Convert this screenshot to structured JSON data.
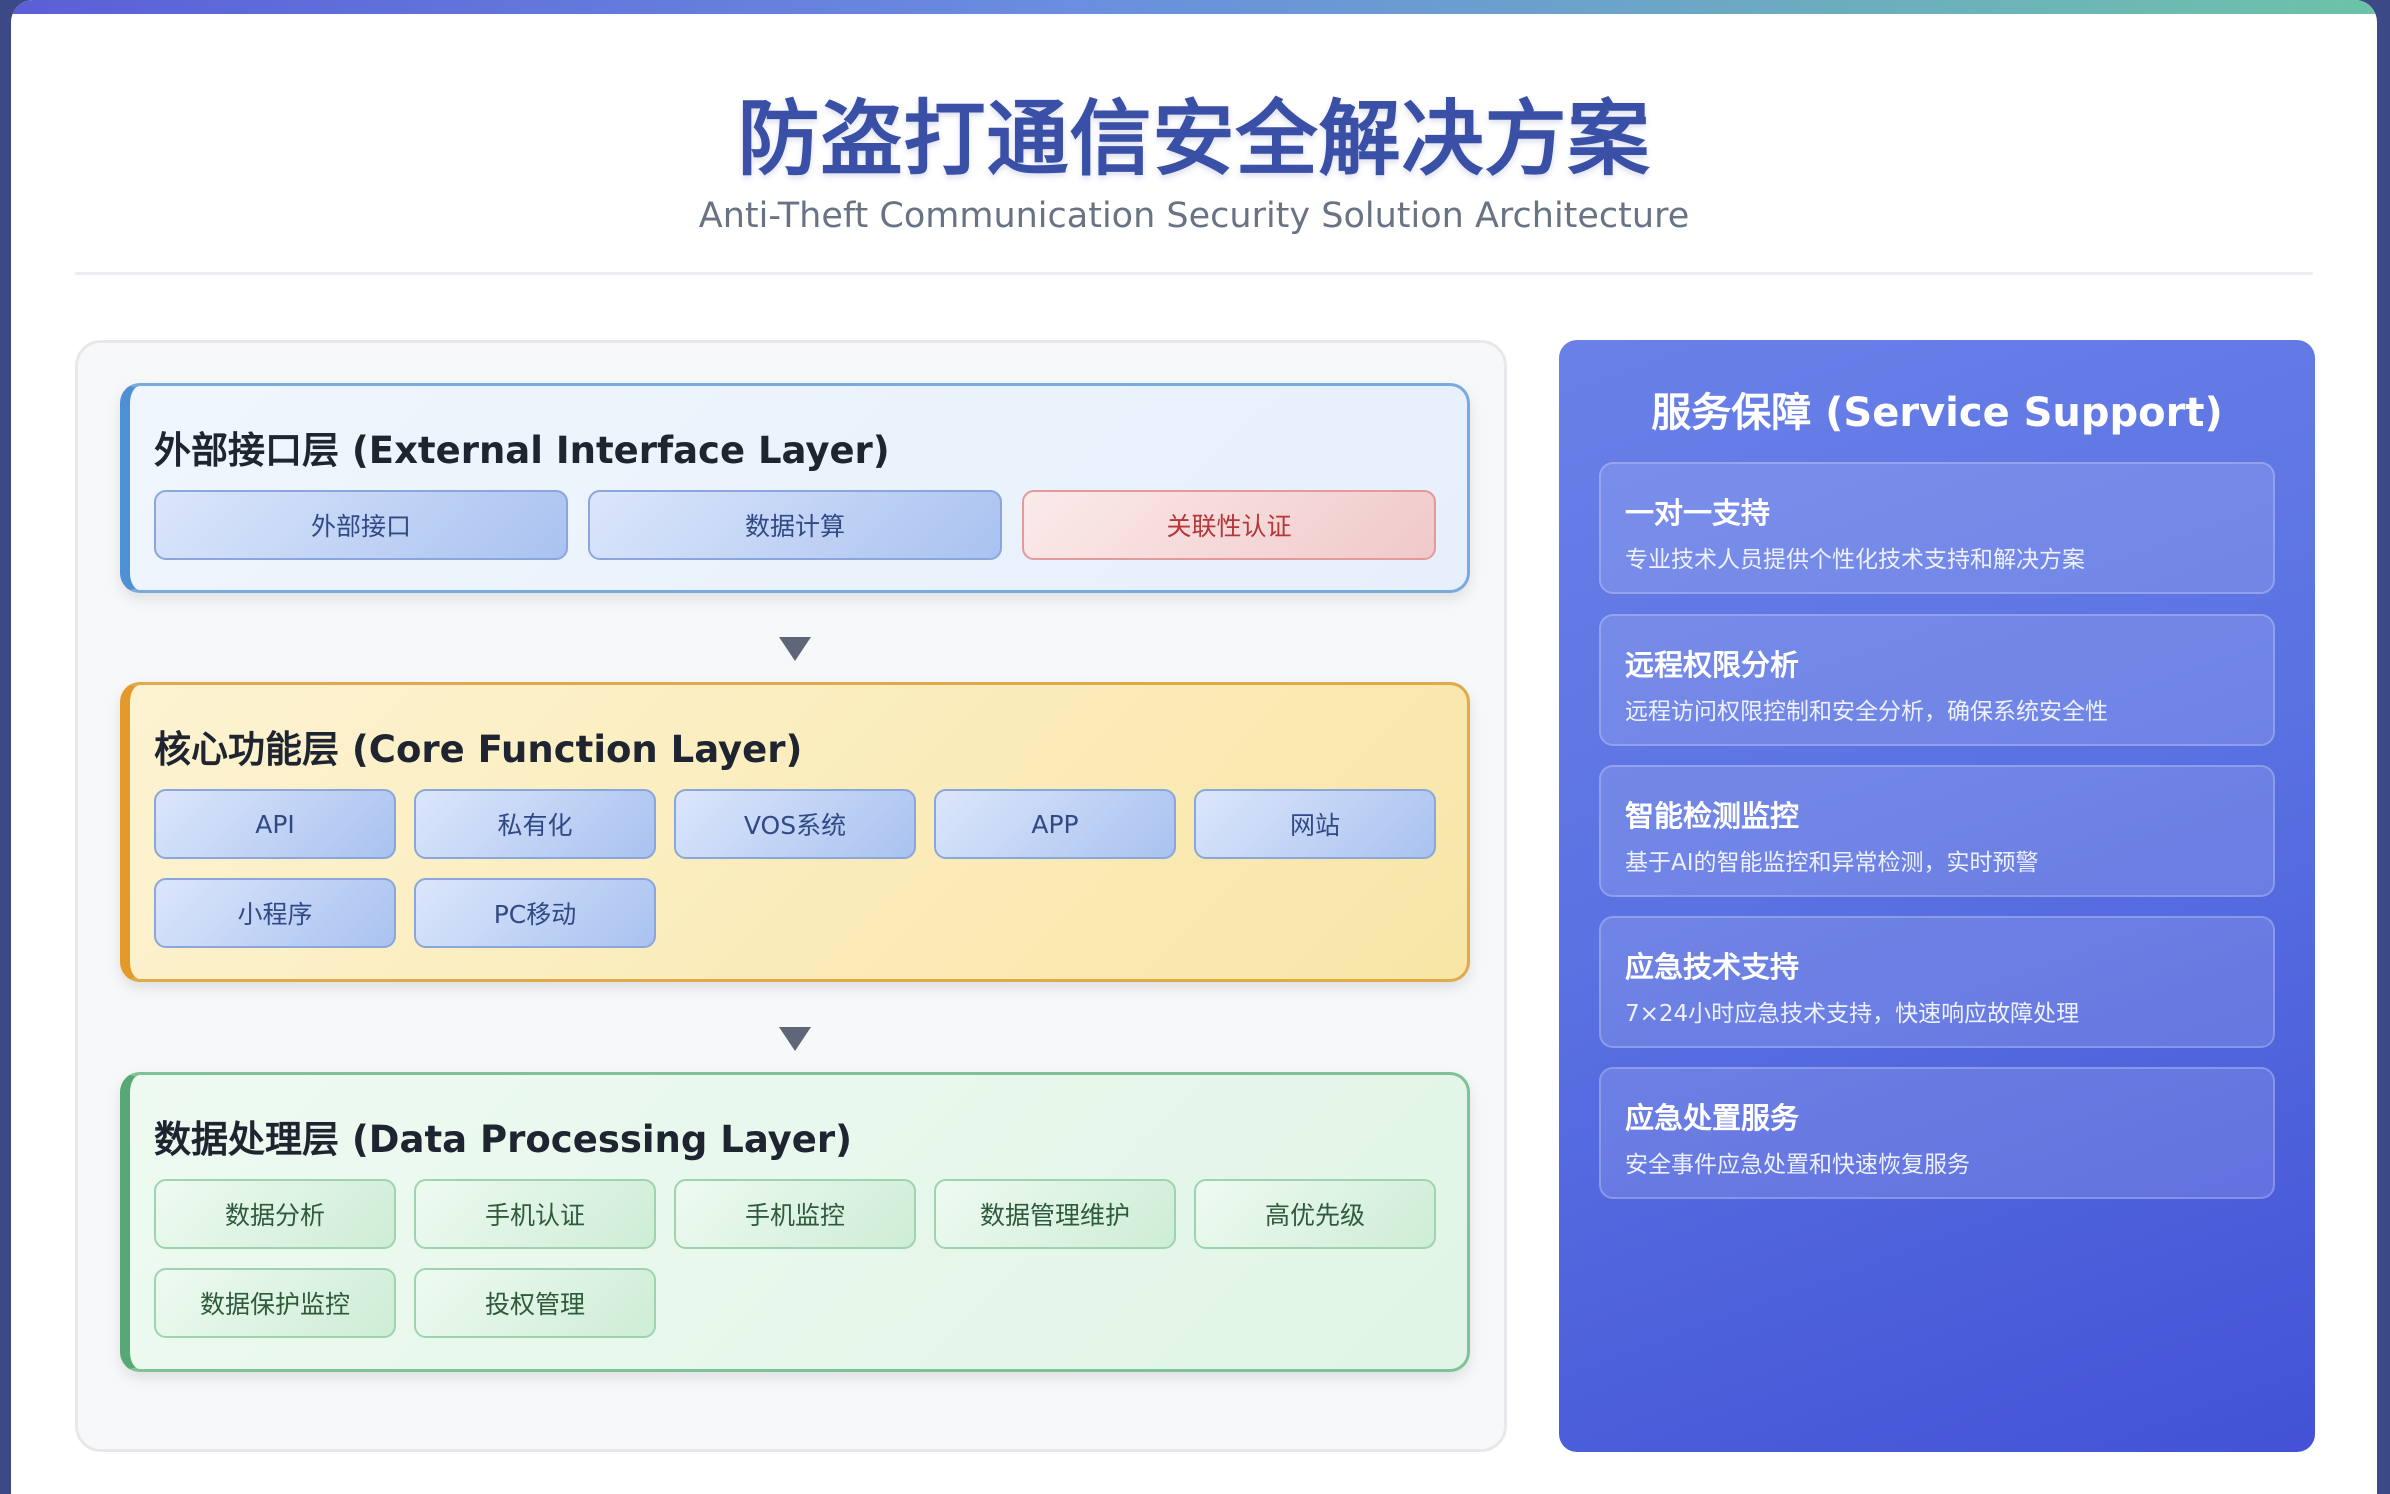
{
  "header": {
    "title": "防盗打通信安全解决方案",
    "subtitle": "Anti-Theft Communication Security Solution Architecture"
  },
  "layers": [
    {
      "title": "外部接口层 (External Interface Layer)",
      "items": [
        "外部接口",
        "数据计算",
        "关联性认证"
      ]
    },
    {
      "title": "核心功能层 (Core Function Layer)",
      "items": [
        "API",
        "私有化",
        "VOS系统",
        "APP",
        "网站",
        "小程序",
        "PC移动"
      ]
    },
    {
      "title": "数据处理层 (Data Processing Layer)",
      "items": [
        "数据分析",
        "手机认证",
        "手机监控",
        "数据管理维护",
        "高优先级",
        "数据保护监控",
        "投权管理"
      ]
    }
  ],
  "service": {
    "title": "服务保障 (Service Support)",
    "cards": [
      {
        "title": "一对一支持",
        "desc": "专业技术人员提供个性化技术支持和解决方案"
      },
      {
        "title": "远程权限分析",
        "desc": "远程访问权限控制和安全分析，确保系统安全性"
      },
      {
        "title": "智能检测监控",
        "desc": "基于AI的智能监控和异常检测，实时预警"
      },
      {
        "title": "应急技术支持",
        "desc": "7×24小时应急技术支持，快速响应故障处理"
      },
      {
        "title": "应急处置服务",
        "desc": "安全事件应急处置和快速恢复服务"
      }
    ]
  },
  "icons": {
    "flow_arrow": "down-triangle-icon"
  },
  "colors": {
    "title": "#3a50a6",
    "interface_accent": "#4f8fd3",
    "core_accent": "#e39a2a",
    "data_accent": "#56a874",
    "service_panel": "#5a72e2",
    "highlight_chip_text": "#b7363a"
  }
}
